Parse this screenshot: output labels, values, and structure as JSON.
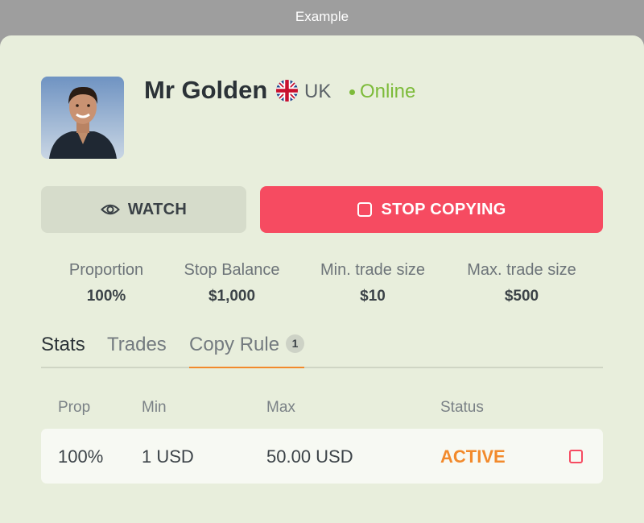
{
  "window": {
    "title": "Example"
  },
  "profile": {
    "name": "Mr Golden",
    "country": "UK",
    "status": "Online",
    "flag_icon": "uk-flag-icon",
    "avatar_icon": "user-photo"
  },
  "actions": {
    "watch_label": "WATCH",
    "stop_label": "STOP COPYING",
    "watch_icon": "eye-icon",
    "stop_icon": "square-icon"
  },
  "settings": [
    {
      "label": "Proportion",
      "value": "100%"
    },
    {
      "label": "Stop Balance",
      "value": "$1,000"
    },
    {
      "label": "Min. trade size",
      "value": "$10"
    },
    {
      "label": "Max. trade size",
      "value": "$500"
    }
  ],
  "tabs": [
    {
      "label": "Stats"
    },
    {
      "label": "Trades"
    },
    {
      "label": "Copy Rule",
      "badge": "1"
    }
  ],
  "table": {
    "headers": [
      "Prop",
      "Min",
      "Max",
      "Status"
    ],
    "rows": [
      {
        "prop": "100%",
        "min": "1 USD",
        "max": "50.00 USD",
        "status": "ACTIVE"
      }
    ]
  },
  "colors": {
    "accent_red": "#f64b61",
    "online_green": "#7dbb3a",
    "active_orange": "#f28a2c",
    "card_bg": "#e8eedc"
  }
}
